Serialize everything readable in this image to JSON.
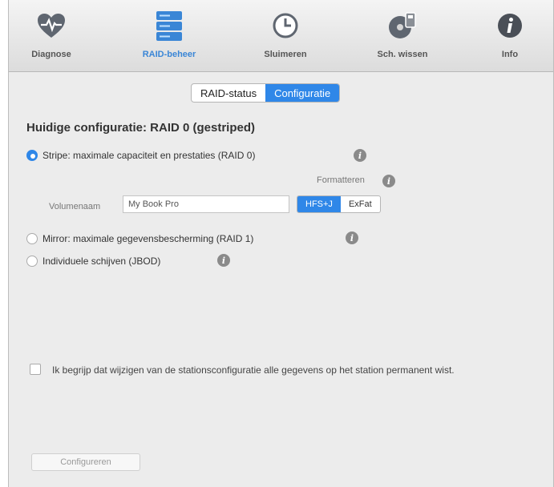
{
  "toolbar": {
    "items": [
      {
        "label": "Diagnose",
        "icon": "heart-pulse-icon"
      },
      {
        "label": "RAID-beheer",
        "icon": "raid-disks-icon"
      },
      {
        "label": "Sluimeren",
        "icon": "clock-icon"
      },
      {
        "label": "Sch. wissen",
        "icon": "disk-erase-icon"
      },
      {
        "label": "Info",
        "icon": "info-icon"
      }
    ],
    "active_index": 1,
    "accent": "#3a86d6"
  },
  "tabs": {
    "items": [
      "RAID-status",
      "Configuratie"
    ],
    "selected": "Configuratie"
  },
  "config": {
    "title": "Huidige configuratie: RAID 0 (gestriped)",
    "options": {
      "stripe": "Stripe: maximale capaciteit en prestaties (RAID 0)",
      "mirror": "Mirror: maximale gegevensbescherming (RAID 1)",
      "jbod": "Individuele schijven (JBOD)"
    },
    "selected_option": "stripe",
    "format_label": "Formatteren",
    "volume_label": "Volumenaam",
    "volume_value": "My Book Pro",
    "filesystems": [
      "HFS+J",
      "ExFat"
    ],
    "selected_filesystem": "HFS+J"
  },
  "confirm": {
    "text": "Ik begrijp dat wijzigen van de stationsconfiguratie alle gegevens op het station permanent wist.",
    "checked": false
  },
  "actions": {
    "configure_label": "Configureren"
  },
  "colors": {
    "selected_blue": "#2f87e8",
    "background": "#ececec"
  }
}
